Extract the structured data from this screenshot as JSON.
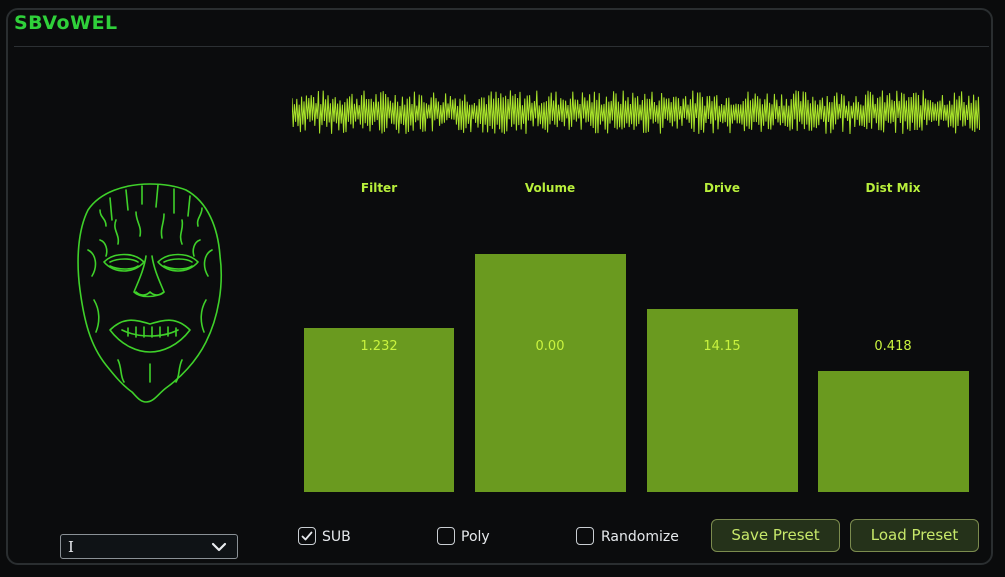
{
  "app": {
    "title": "SBVoWEL"
  },
  "colors": {
    "accent": "#2fd03a",
    "bar": "#6a9a1f",
    "wave": "#a9e42a",
    "label": "#b9f03c",
    "button_bg": "#25321a"
  },
  "icons": {
    "mask": "melting-face-icon",
    "chevron": "chevron-down-icon",
    "check": "checkmark-icon"
  },
  "params": [
    {
      "label": "Filter",
      "value": "1.232",
      "level": 0.69
    },
    {
      "label": "Volume",
      "value": "0.00",
      "level": 1.0
    },
    {
      "label": "Drive",
      "value": "14.15",
      "level": 0.77
    },
    {
      "label": "Dist Mix",
      "value": "0.418",
      "level": 0.51
    }
  ],
  "preset_select": {
    "value": "I"
  },
  "options": [
    {
      "label": "SUB",
      "checked": true
    },
    {
      "label": "Poly",
      "checked": false
    },
    {
      "label": "Randomize",
      "checked": false
    }
  ],
  "buttons": {
    "save": "Save Preset",
    "load": "Load Preset"
  }
}
